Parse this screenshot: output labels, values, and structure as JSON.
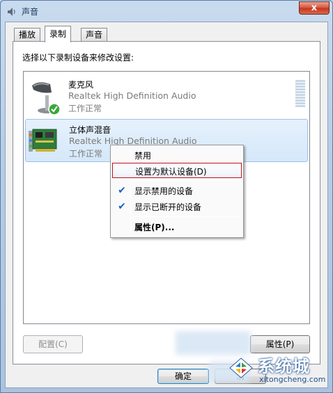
{
  "window": {
    "title": "声音",
    "close_label": "x"
  },
  "tabs": [
    {
      "label": "播放",
      "active": false
    },
    {
      "label": "录制",
      "active": true
    },
    {
      "label": "声音",
      "active": false
    }
  ],
  "panel": {
    "instruction": "选择以下录制设备来修改设置:"
  },
  "devices": [
    {
      "name": "麦克风",
      "driver": "Realtek High Definition Audio",
      "status": "工作正常",
      "icon": "microphone-icon",
      "default": true
    },
    {
      "name": "立体声混音",
      "driver": "Realtek High Definition Audio",
      "status": "工作正常",
      "icon": "sound-card-icon",
      "selected": true
    }
  ],
  "context_menu": {
    "items": [
      {
        "label": "禁用",
        "checked": false
      },
      {
        "label": "设置为默认设备(D)",
        "checked": false,
        "highlight": true
      },
      {
        "label": "显示禁用的设备",
        "checked": true
      },
      {
        "label": "显示已断开的设备",
        "checked": true
      },
      {
        "label": "属性(P)...",
        "checked": false,
        "bold": true
      }
    ]
  },
  "buttons": {
    "configure": "配置(C)",
    "properties": "属性(P)",
    "ok": "确定",
    "cancel_partial": "消"
  },
  "watermark": {
    "title": "系统城",
    "url": "xitongcheng.com"
  },
  "colors": {
    "selection": "#d5e8fa",
    "check": "#1a5ec7",
    "highlight_border": "#c1121f"
  }
}
